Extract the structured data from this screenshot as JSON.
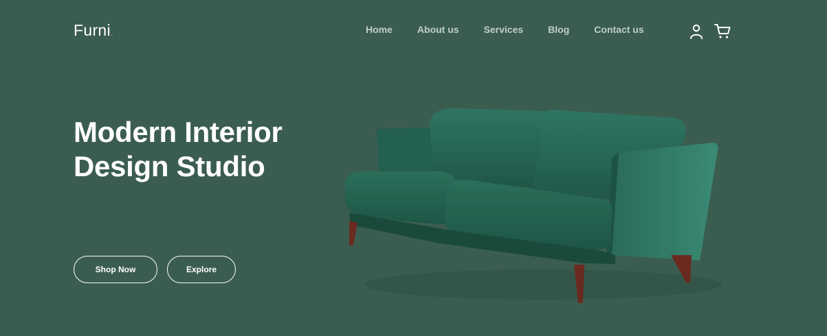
{
  "header": {
    "logo": "Furni",
    "logo_dot": ".",
    "nav": [
      "Home",
      "About us",
      "Services",
      "Blog",
      "Contact us"
    ],
    "icons": [
      "user-icon",
      "cart-icon"
    ]
  },
  "hero": {
    "title_line1": "Modern Interior",
    "title_line2": "Design Studio",
    "buttons": {
      "shop": "Shop Now",
      "explore": "Explore"
    },
    "image": "green-velvet-sofa"
  },
  "colors": {
    "background": "#3b5d50",
    "text": "#ffffff",
    "nav_text": "#bfcfc8",
    "sofa": "#2f6b58"
  }
}
